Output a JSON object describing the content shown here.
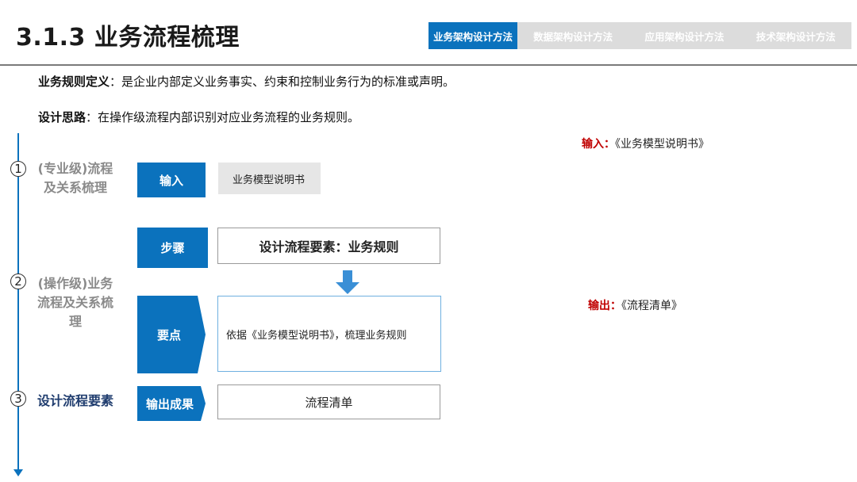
{
  "header": {
    "title": "3.1.3 业务流程梳理",
    "tabs": [
      "业务架构设计方法",
      "数据架构设计方法",
      "应用架构设计方法",
      "技术架构设计方法"
    ]
  },
  "intro": {
    "definition_label": "业务规则定义",
    "definition_text": "：是企业内部定义业务事实、约束和控制业务行为的标准或声明。",
    "idea_label": "设计思路",
    "idea_text": "：在操作级流程内部识别对应业务流程的业务规则。"
  },
  "stages": [
    {
      "num": "1",
      "name": "(专业级)流程及关系梳理"
    },
    {
      "num": "2",
      "name": "(操作级)业务流程及关系梳理"
    },
    {
      "num": "3",
      "name": "设计流程要素"
    }
  ],
  "flow": {
    "input_label": "输入",
    "input_value": "业务模型说明书",
    "step_label": "步骤",
    "step_value": "设计流程要素：业务规则",
    "key_label": "要点",
    "key_value": "依据《业务模型说明书》，梳理业务规则",
    "output_label": "输出成果",
    "output_value": "流程清单"
  },
  "side": {
    "input_key": "输入：",
    "input_value": "《业务模型说明书》",
    "output_key": "输出：",
    "output_value": "《流程清单》"
  },
  "colors": {
    "accent": "#0b72bd",
    "highlight": "#c00000",
    "tab_bg": "#dcdcdc"
  }
}
